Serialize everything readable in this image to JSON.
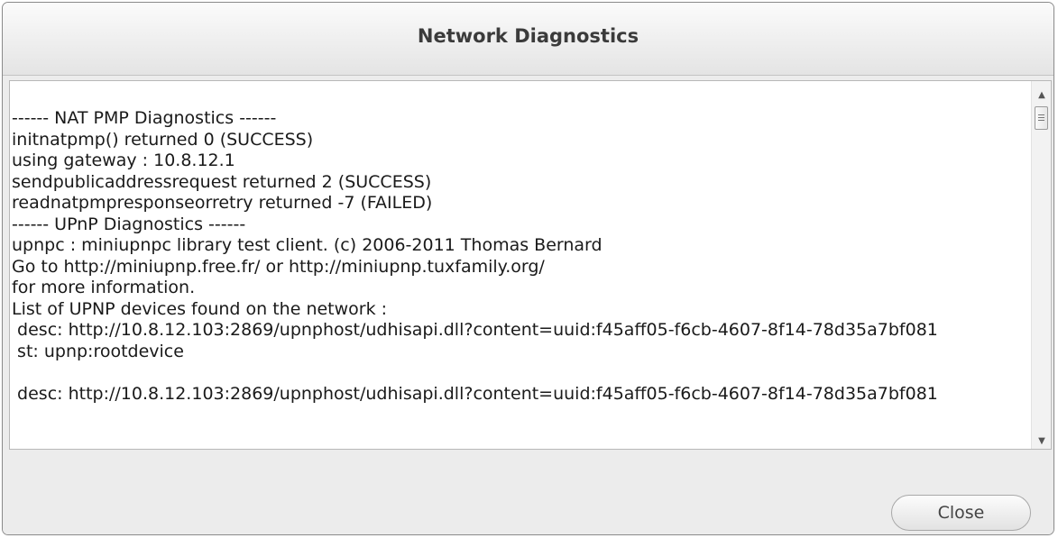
{
  "dialog": {
    "title": "Network Diagnostics",
    "close_label": "Close"
  },
  "log": {
    "lines": [
      "------ NAT PMP Diagnostics ------",
      "initnatpmp() returned 0 (SUCCESS)",
      "using gateway : 10.8.12.1",
      "sendpublicaddressrequest returned 2 (SUCCESS)",
      "readnatpmpresponseorretry returned -7 (FAILED)",
      "------ UPnP Diagnostics ------",
      "upnpc : miniupnpc library test client. (c) 2006-2011 Thomas Bernard",
      "Go to http://miniupnp.free.fr/ or http://miniupnp.tuxfamily.org/",
      "for more information.",
      "List of UPNP devices found on the network :",
      " desc: http://10.8.12.103:2869/upnphost/udhisapi.dll?content=uuid:f45aff05-f6cb-4607-8f14-78d35a7bf081",
      " st: upnp:rootdevice",
      "",
      " desc: http://10.8.12.103:2869/upnphost/udhisapi.dll?content=uuid:f45aff05-f6cb-4607-8f14-78d35a7bf081"
    ]
  },
  "icons": {
    "scroll_up": "up-arrow-icon",
    "scroll_down": "down-arrow-icon",
    "thumb_grip": "grip-icon"
  }
}
